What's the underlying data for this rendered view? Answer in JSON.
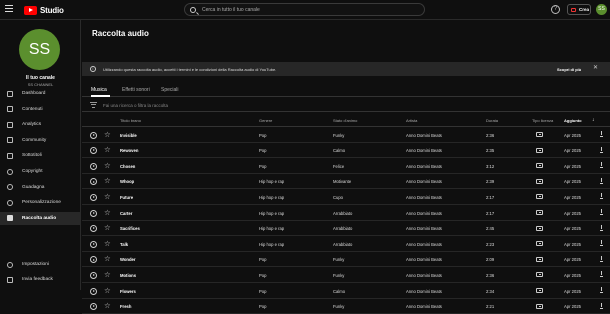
{
  "header": {
    "logo_text": "Studio",
    "search_placeholder": "Cerca in tutto il tuo canale",
    "create_label": "Crea",
    "avatar_initials": "SS"
  },
  "sidebar": {
    "avatar_initials": "SS",
    "channel_name": "Il tuo canale",
    "channel_sub": "SS CHANNEL",
    "items": [
      {
        "label": "Dashboard",
        "icon": "dashboard-icon",
        "active": false
      },
      {
        "label": "Contenuti",
        "icon": "content-icon",
        "active": false
      },
      {
        "label": "Analytics",
        "icon": "analytics-icon",
        "active": false
      },
      {
        "label": "Community",
        "icon": "community-icon",
        "active": false
      },
      {
        "label": "Sottotitoli",
        "icon": "subtitles-icon",
        "active": false
      },
      {
        "label": "Copyright",
        "icon": "copyright-icon",
        "active": false
      },
      {
        "label": "Guadagna",
        "icon": "earn-icon",
        "active": false
      },
      {
        "label": "Personalizzazione",
        "icon": "customization-icon",
        "active": false
      },
      {
        "label": "Raccolta audio",
        "icon": "audio-library-icon",
        "active": true
      }
    ],
    "bottom_items": [
      {
        "label": "Impostazioni",
        "icon": "settings-icon"
      },
      {
        "label": "Invia feedback",
        "icon": "feedback-icon"
      }
    ]
  },
  "main": {
    "title": "Raccolta audio",
    "banner_text": "Utilizzando questa raccolta audio, accetti i termini e le condizioni della Raccolta audio di YouTube.",
    "banner_button": "Scopri di più",
    "tabs": [
      "Musica",
      "Effetti sonori",
      "Speciali"
    ],
    "active_tab": "Musica",
    "filter_placeholder": "Fai una ricerca o filtra la raccolta",
    "columns": {
      "title": "Titolo brano",
      "genre": "Genere",
      "mood": "Stato d'animo",
      "artist": "Artista",
      "duration": "Durata",
      "license": "Tipo licenza",
      "added": "Aggiunto"
    },
    "tracks": [
      {
        "title": "Invisible",
        "genre": "Pop",
        "mood": "Funky",
        "artist": "Anno Domini Beats",
        "duration": "2:36",
        "added": "Apr 2025"
      },
      {
        "title": "Rewoven",
        "genre": "Pop",
        "mood": "Calmo",
        "artist": "Anno Domini Beats",
        "duration": "2:35",
        "added": "Apr 2025"
      },
      {
        "title": "Chosen",
        "genre": "Pop",
        "mood": "Felice",
        "artist": "Anno Domini Beats",
        "duration": "3:12",
        "added": "Apr 2025"
      },
      {
        "title": "Whoop",
        "genre": "Hip hop e rap",
        "mood": "Motivante",
        "artist": "Anno Domini Beats",
        "duration": "2:39",
        "added": "Apr 2025"
      },
      {
        "title": "Future",
        "genre": "Hip hop e rap",
        "mood": "Cupo",
        "artist": "Anno Domini Beats",
        "duration": "2:17",
        "added": "Apr 2025"
      },
      {
        "title": "Carter",
        "genre": "Hip hop e rap",
        "mood": "Arrabbiato",
        "artist": "Anno Domini Beats",
        "duration": "2:17",
        "added": "Apr 2025"
      },
      {
        "title": "Sacrifices",
        "genre": "Hip hop e rap",
        "mood": "Arrabbiato",
        "artist": "Anno Domini Beats",
        "duration": "2:45",
        "added": "Apr 2025"
      },
      {
        "title": "Talk",
        "genre": "Hip hop e rap",
        "mood": "Arrabbiato",
        "artist": "Anno Domini Beats",
        "duration": "2:23",
        "added": "Apr 2025"
      },
      {
        "title": "Wonder",
        "genre": "Pop",
        "mood": "Funky",
        "artist": "Anno Domini Beats",
        "duration": "2:09",
        "added": "Apr 2025"
      },
      {
        "title": "Motions",
        "genre": "Pop",
        "mood": "Funky",
        "artist": "Anno Domini Beats",
        "duration": "2:36",
        "added": "Apr 2025"
      },
      {
        "title": "Flowers",
        "genre": "Pop",
        "mood": "Calmo",
        "artist": "Anno Domini Beats",
        "duration": "2:34",
        "added": "Apr 2025"
      },
      {
        "title": "Fresh",
        "genre": "Pop",
        "mood": "Funky",
        "artist": "Anno Domini Beats",
        "duration": "2:21",
        "added": "Apr 2025"
      }
    ]
  },
  "colors": {
    "background": "#0f0f0f",
    "brand_red": "#ff0000",
    "avatar_green": "#5b8f2e",
    "active_nav": "#282828"
  }
}
